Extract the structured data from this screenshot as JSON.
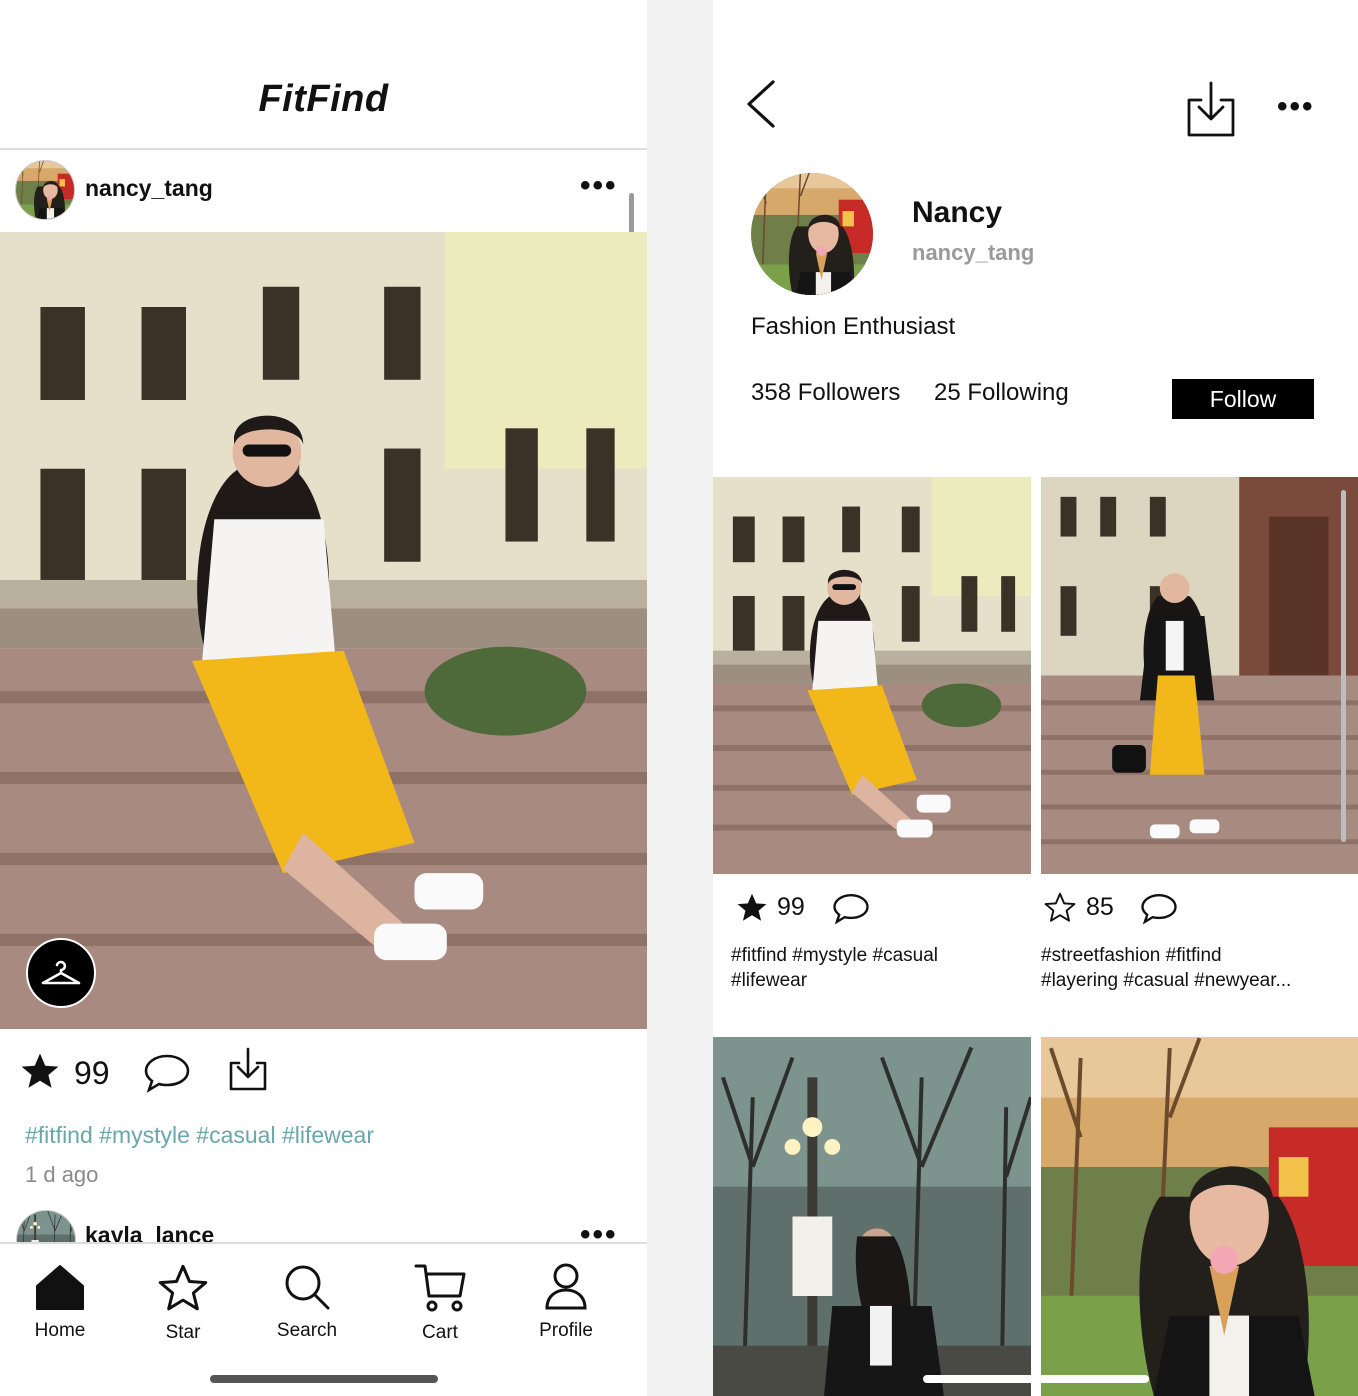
{
  "feed": {
    "app_title": "FitFind",
    "post": {
      "username": "nancy_tang",
      "stars": "99",
      "hashtags": "#fitfind #mystyle #casual #lifewear",
      "time_ago": "1 d ago"
    },
    "next_post": {
      "username": "kayla_lance"
    },
    "nav": [
      {
        "label": "Home",
        "icon": "home-icon"
      },
      {
        "label": "Star",
        "icon": "star-icon"
      },
      {
        "label": "Search",
        "icon": "search-icon"
      },
      {
        "label": "Cart",
        "icon": "cart-icon"
      },
      {
        "label": "Profile",
        "icon": "profile-icon"
      }
    ]
  },
  "profile": {
    "name": "Nancy",
    "username": "nancy_tang",
    "bio": "Fashion Enthusiast",
    "followers": "358 Followers",
    "following": "25 Following",
    "follow_label": "Follow",
    "posts": [
      {
        "stars": "99",
        "starred": true,
        "hashtags_line1": "#fitfind #mystyle #casual",
        "hashtags_line2": "#lifewear"
      },
      {
        "stars": "85",
        "starred": false,
        "hashtags_line1": "#streetfashion #fitfind",
        "hashtags_line2": "#layering #casual #newyear..."
      }
    ]
  },
  "colors": {
    "accent": "#000000",
    "hashtag": "#6aa7a7",
    "skirt": "#f2b81a",
    "muted": "#8a8a8a"
  }
}
